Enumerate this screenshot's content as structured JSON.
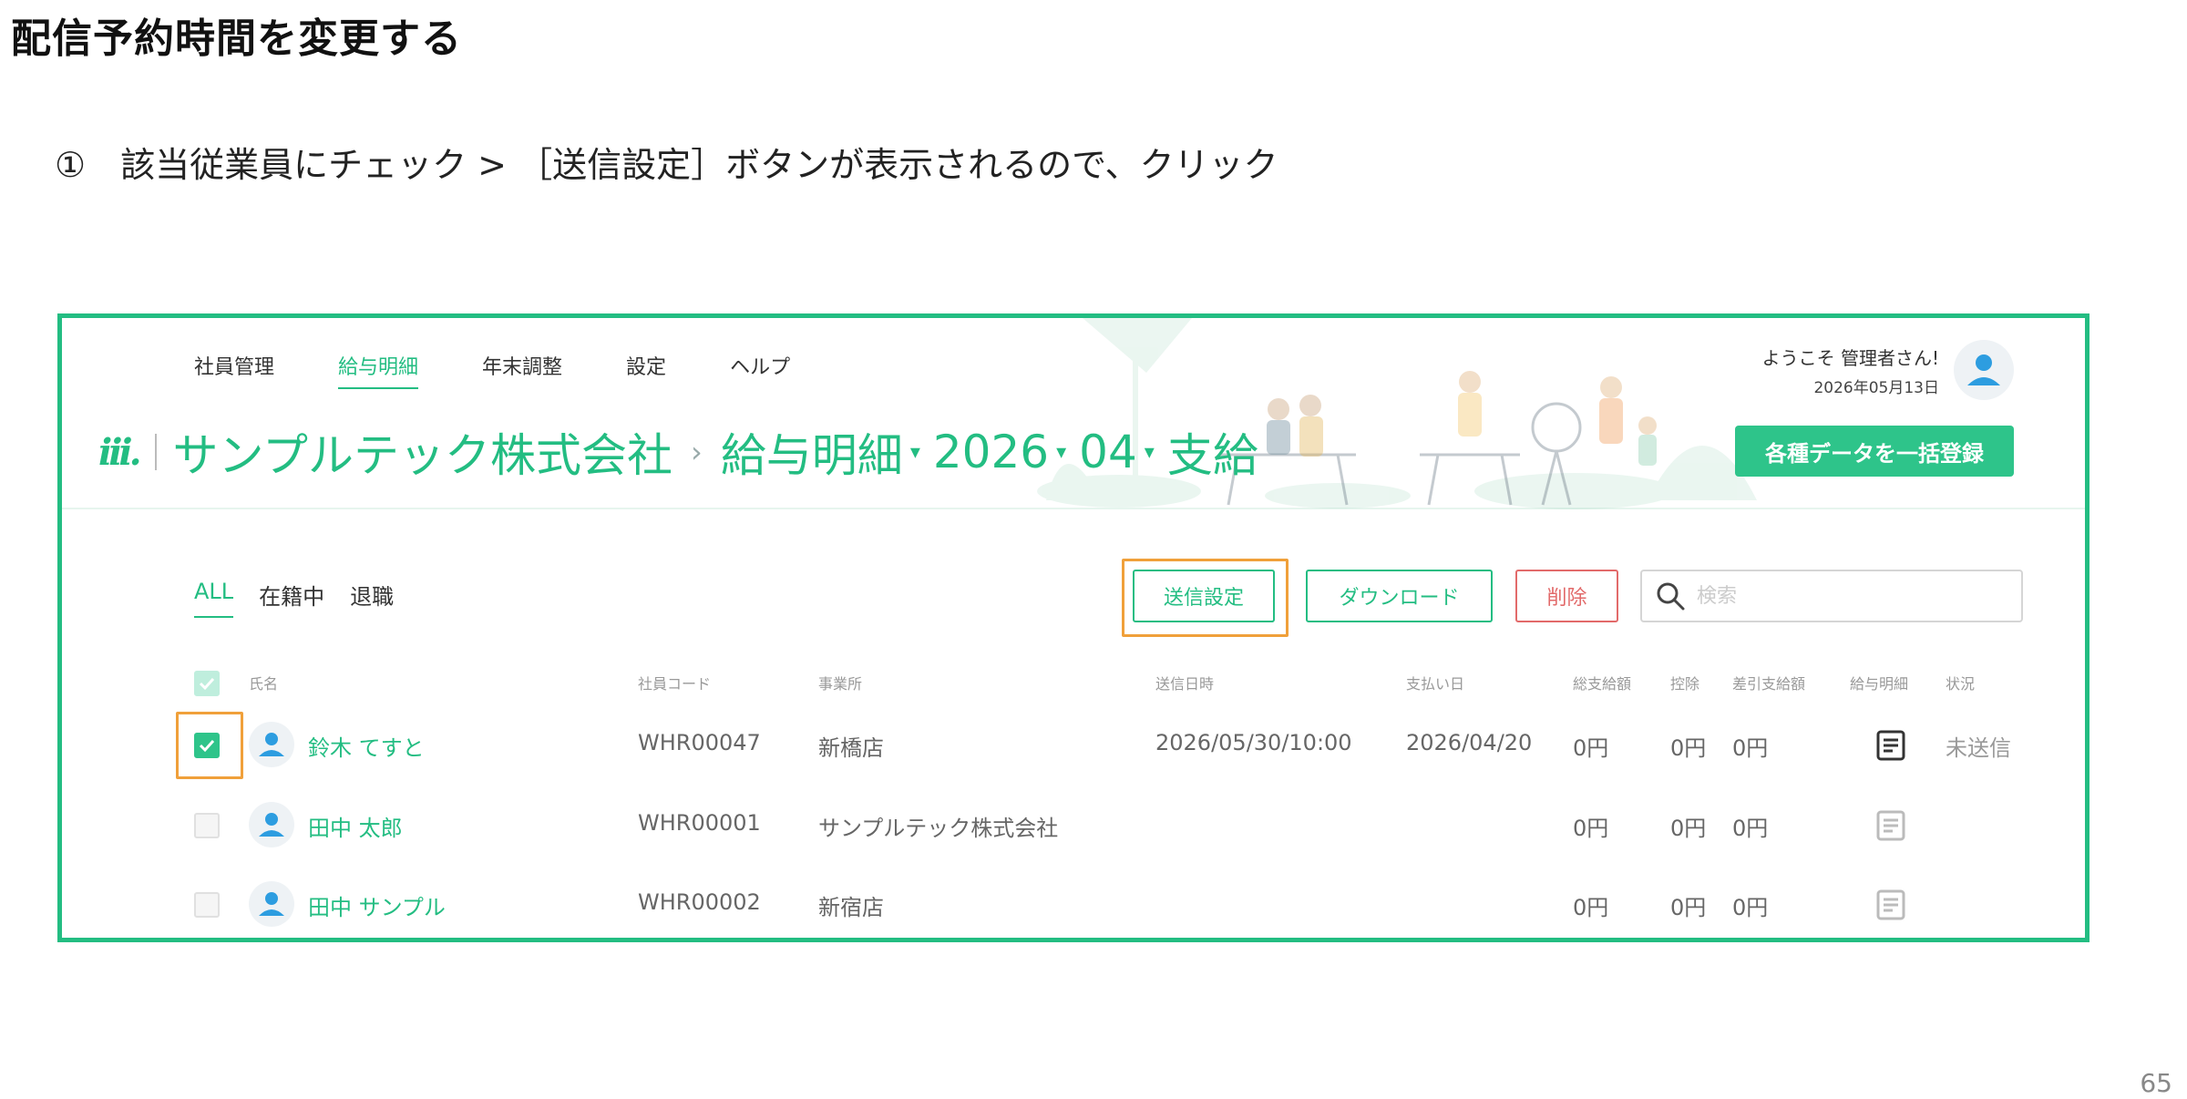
{
  "slide": {
    "title": "配信予約時間を変更する",
    "instruction": "①　該当従業員にチェック > ［送信設定］ボタンが表示されるので、クリック",
    "page_number": "65"
  },
  "app": {
    "nav": [
      "社員管理",
      "給与明細",
      "年末調整",
      "設定",
      "ヘルプ"
    ],
    "active_nav": "給与明細",
    "logo": "iii.",
    "company": "サンプルテック株式会社",
    "breadcrumb": {
      "arrow": "›",
      "section": "給与明細",
      "year": "2026",
      "month": "04",
      "type": "支給",
      "caret": "▾"
    },
    "welcome": "ようこそ 管理者さん!",
    "date": "2026年05月13日",
    "bulk_button": "各種データを一括登録",
    "filters": [
      "ALL",
      "在籍中",
      "退職"
    ],
    "actions": {
      "send_settings": "送信設定",
      "download": "ダウンロード",
      "delete": "削除"
    },
    "search": {
      "placeholder": "検索"
    },
    "accent_color": "#23bd82",
    "highlight_color": "#f0a03a",
    "table": {
      "headers": {
        "name": "氏名",
        "code": "社員コード",
        "office": "事業所",
        "sent_at": "送信日時",
        "pay_date": "支払い日",
        "gross": "総支給額",
        "deduction": "控除",
        "net": "差引支給額",
        "slip": "給与明細",
        "status": "状況"
      },
      "rows": [
        {
          "checked": true,
          "name": "鈴木 てすと",
          "code": "WHR00047",
          "office": "新橋店",
          "sent_at": "2026/05/30/10:00",
          "pay_date": "2026/04/20",
          "gross": "0円",
          "deduction": "0円",
          "net": "0円",
          "status": "未送信"
        },
        {
          "checked": false,
          "name": "田中 太郎",
          "code": "WHR00001",
          "office": "サンプルテック株式会社",
          "sent_at": "",
          "pay_date": "",
          "gross": "0円",
          "deduction": "0円",
          "net": "0円",
          "status": ""
        },
        {
          "checked": false,
          "name": "田中 サンプル",
          "code": "WHR00002",
          "office": "新宿店",
          "sent_at": "",
          "pay_date": "",
          "gross": "0円",
          "deduction": "0円",
          "net": "0円",
          "status": ""
        }
      ]
    }
  }
}
